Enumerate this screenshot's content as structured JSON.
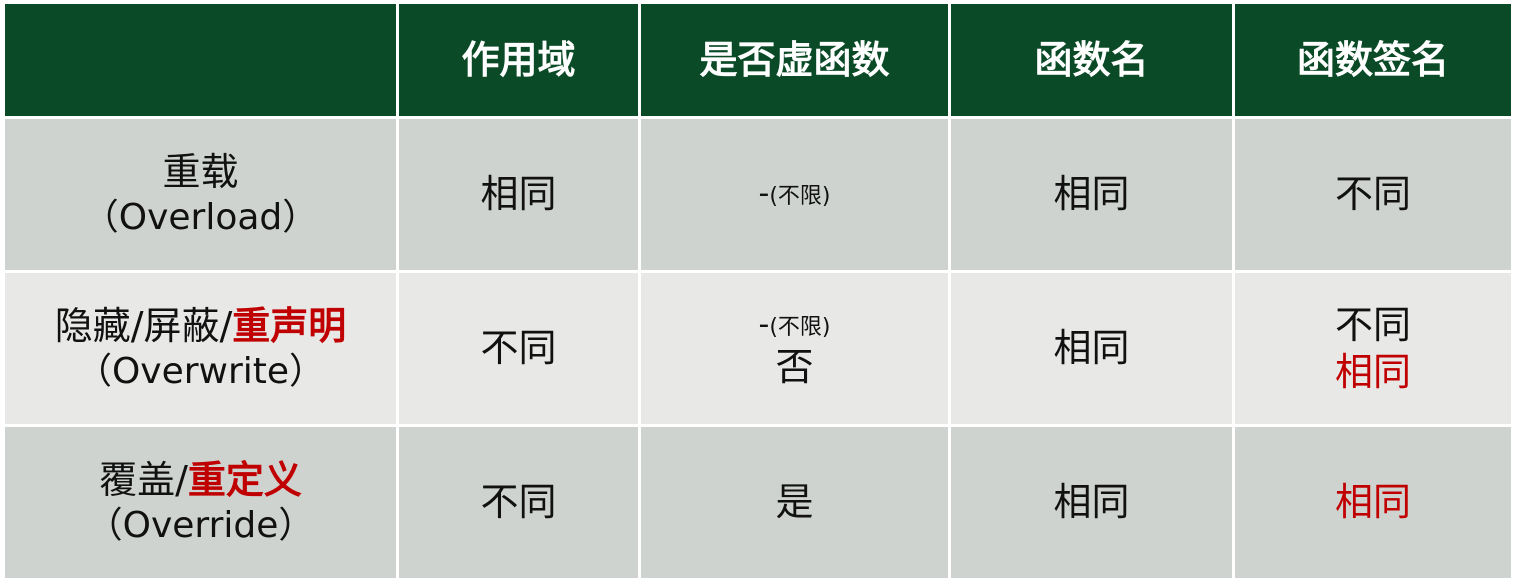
{
  "header": {
    "scope": "作用域",
    "is_virtual": "是否虚函数",
    "func_name": "函数名",
    "signature": "函数签名"
  },
  "rows": [
    {
      "name_cn": "重载",
      "name_en": "（Overload）",
      "scope": "相同",
      "virtual_dash": "-",
      "virtual_note": "(不限)",
      "func_name": "相同",
      "signature": "不同"
    },
    {
      "name_cn_plain": "隐藏/屏蔽/",
      "name_cn_emph": "重声明",
      "name_en": "（Overwrite）",
      "scope": "不同",
      "virtual_dash": "-",
      "virtual_note": "(不限)",
      "virtual_alt": "否",
      "func_name": "相同",
      "signature": "不同",
      "signature_alt": "相同"
    },
    {
      "name_cn_plain": "覆盖/",
      "name_cn_emph": "重定义",
      "name_en": "（Override）",
      "scope": "不同",
      "virtual": "是",
      "func_name": "相同",
      "signature": "相同"
    }
  ],
  "colors": {
    "header_bg": "#0b4a26",
    "row_odd_bg": "#cfd3cf",
    "row_even_bg": "#e8e8e7",
    "emphasis_red": "#c00000"
  }
}
